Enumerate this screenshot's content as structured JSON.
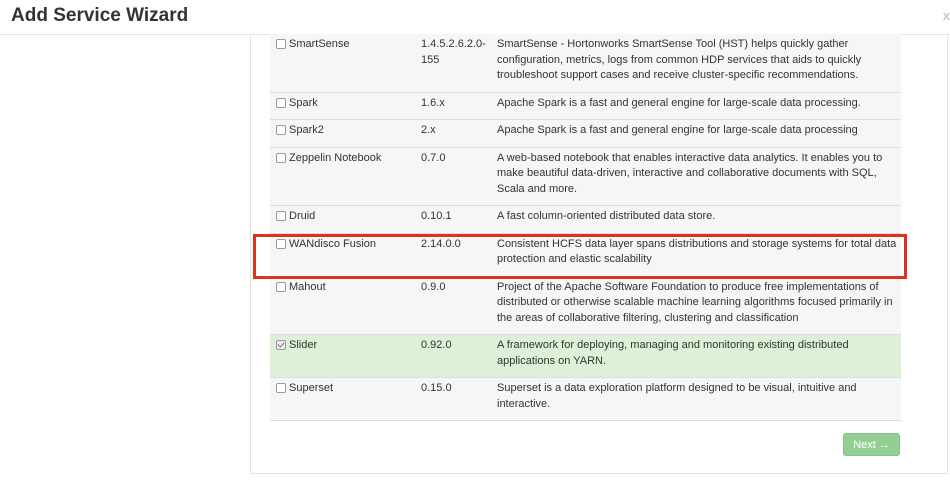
{
  "header": {
    "title": "Add Service Wizard",
    "close": "x"
  },
  "services": [
    {
      "name": "SmartSense",
      "version_lines": [
        "1.4.5.2.6.2.0-",
        "155"
      ],
      "description_lines": [
        "SmartSense - Hortonworks SmartSense Tool (HST) helps quickly gather",
        "configuration, metrics, logs from common HDP services that aids to quickly",
        "troubleshoot support cases and receive cluster-specific recommendations."
      ],
      "checked": false
    },
    {
      "name": "Spark",
      "version_lines": [
        "1.6.x"
      ],
      "description_lines": [
        "Apache Spark is a fast and general engine for large-scale data processing."
      ],
      "checked": false
    },
    {
      "name": "Spark2",
      "version_lines": [
        "2.x"
      ],
      "description_lines": [
        "Apache Spark is a fast and general engine for large-scale data processing"
      ],
      "checked": false
    },
    {
      "name": "Zeppelin Notebook",
      "version_lines": [
        "0.7.0"
      ],
      "description_lines": [
        "A web-based notebook that enables interactive data analytics. It enables you to",
        "make beautiful data-driven, interactive and collaborative documents with SQL,",
        "Scala and more."
      ],
      "checked": false
    },
    {
      "name": "Druid",
      "version_lines": [
        "0.10.1"
      ],
      "description_lines": [
        "A fast column-oriented distributed data store."
      ],
      "checked": false
    },
    {
      "name": "WANdisco Fusion",
      "version_lines": [
        "2.14.0.0"
      ],
      "description_lines": [
        "Consistent HCFS data layer spans distributions and storage systems for total data",
        "protection and elastic scalability"
      ],
      "checked": false
    },
    {
      "name": "Mahout",
      "version_lines": [
        "0.9.0"
      ],
      "description_lines": [
        "Project of the Apache Software Foundation to produce free implementations of",
        "distributed or otherwise scalable machine learning algorithms focused primarily in",
        "the areas of collaborative filtering, clustering and classification"
      ],
      "checked": false
    },
    {
      "name": "Slider",
      "version_lines": [
        "0.92.0"
      ],
      "description_lines": [
        "A framework for deploying, managing and monitoring existing distributed",
        "applications on YARN."
      ],
      "checked": true
    },
    {
      "name": "Superset",
      "version_lines": [
        "0.15.0"
      ],
      "description_lines": [
        "Superset is a data exploration platform designed to be visual, intuitive and",
        "interactive."
      ],
      "checked": false
    }
  ],
  "footer": {
    "next_label": "Next",
    "next_arrow": "→"
  }
}
